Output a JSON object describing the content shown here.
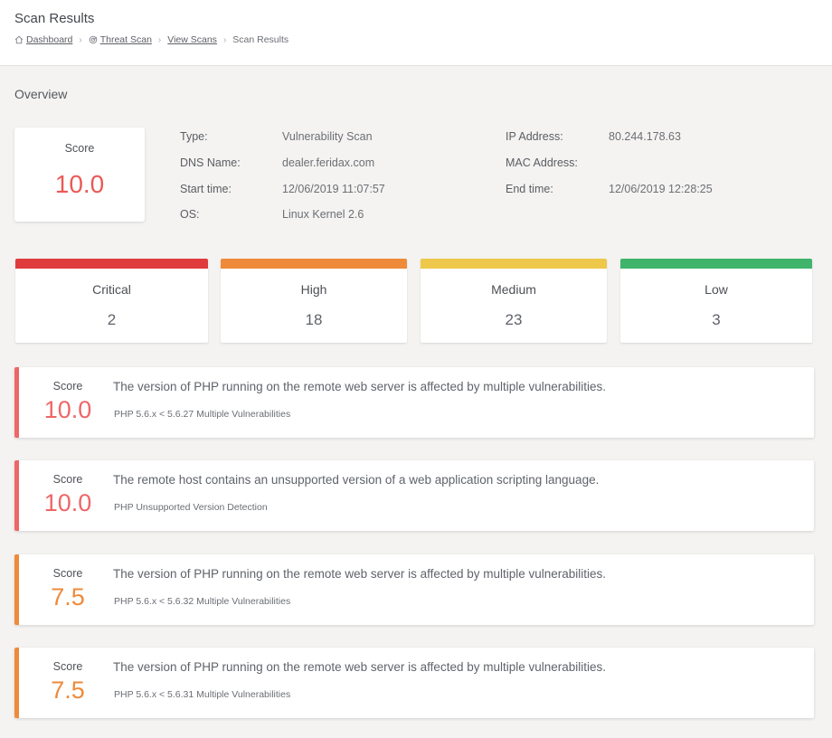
{
  "header": {
    "title": "Scan Results",
    "breadcrumb": [
      {
        "label": "Dashboard",
        "icon": "home-icon"
      },
      {
        "label": "Threat Scan",
        "icon": "scan-icon"
      },
      {
        "label": "View Scans"
      },
      {
        "label": "Scan Results"
      }
    ]
  },
  "overview": {
    "title": "Overview",
    "score_label": "Score",
    "score": "10.0",
    "score_color": "#ea5a57",
    "left": [
      {
        "key": "Type:",
        "value": "Vulnerability Scan"
      },
      {
        "key": "DNS Name:",
        "value": "dealer.feridax.com"
      },
      {
        "key": "Start time:",
        "value": "12/06/2019 11:07:57"
      },
      {
        "key": "OS:",
        "value": "Linux Kernel 2.6"
      }
    ],
    "right": [
      {
        "key": "IP Address:",
        "value": "80.244.178.63"
      },
      {
        "key": "MAC Address:",
        "value": ""
      },
      {
        "key": "End time:",
        "value": "12/06/2019 12:28:25"
      }
    ]
  },
  "severity": [
    {
      "name": "Critical",
      "count": "2",
      "color": "#e03b3c"
    },
    {
      "name": "High",
      "count": "18",
      "color": "#ee8a3a"
    },
    {
      "name": "Medium",
      "count": "23",
      "color": "#eec84a"
    },
    {
      "name": "Low",
      "count": "3",
      "color": "#3fb46a"
    }
  ],
  "findings": [
    {
      "score_label": "Score",
      "score": "10.0",
      "color": "#ef6667",
      "description": "The version of PHP running on the remote web server is affected by multiple vulnerabilities.",
      "plugin": "PHP 5.6.x < 5.6.27 Multiple Vulnerabilities"
    },
    {
      "score_label": "Score",
      "score": "10.0",
      "color": "#ef6667",
      "description": "The remote host contains an unsupported version of a web application scripting language.",
      "plugin": "PHP Unsupported Version Detection"
    },
    {
      "score_label": "Score",
      "score": "7.5",
      "color": "#ee8a3a",
      "description": "The version of PHP running on the remote web server is affected by multiple vulnerabilities.",
      "plugin": "PHP 5.6.x < 5.6.32 Multiple Vulnerabilities"
    },
    {
      "score_label": "Score",
      "score": "7.5",
      "color": "#ee8a3a",
      "description": "The version of PHP running on the remote web server is affected by multiple vulnerabilities.",
      "plugin": "PHP 5.6.x < 5.6.31 Multiple Vulnerabilities"
    }
  ]
}
